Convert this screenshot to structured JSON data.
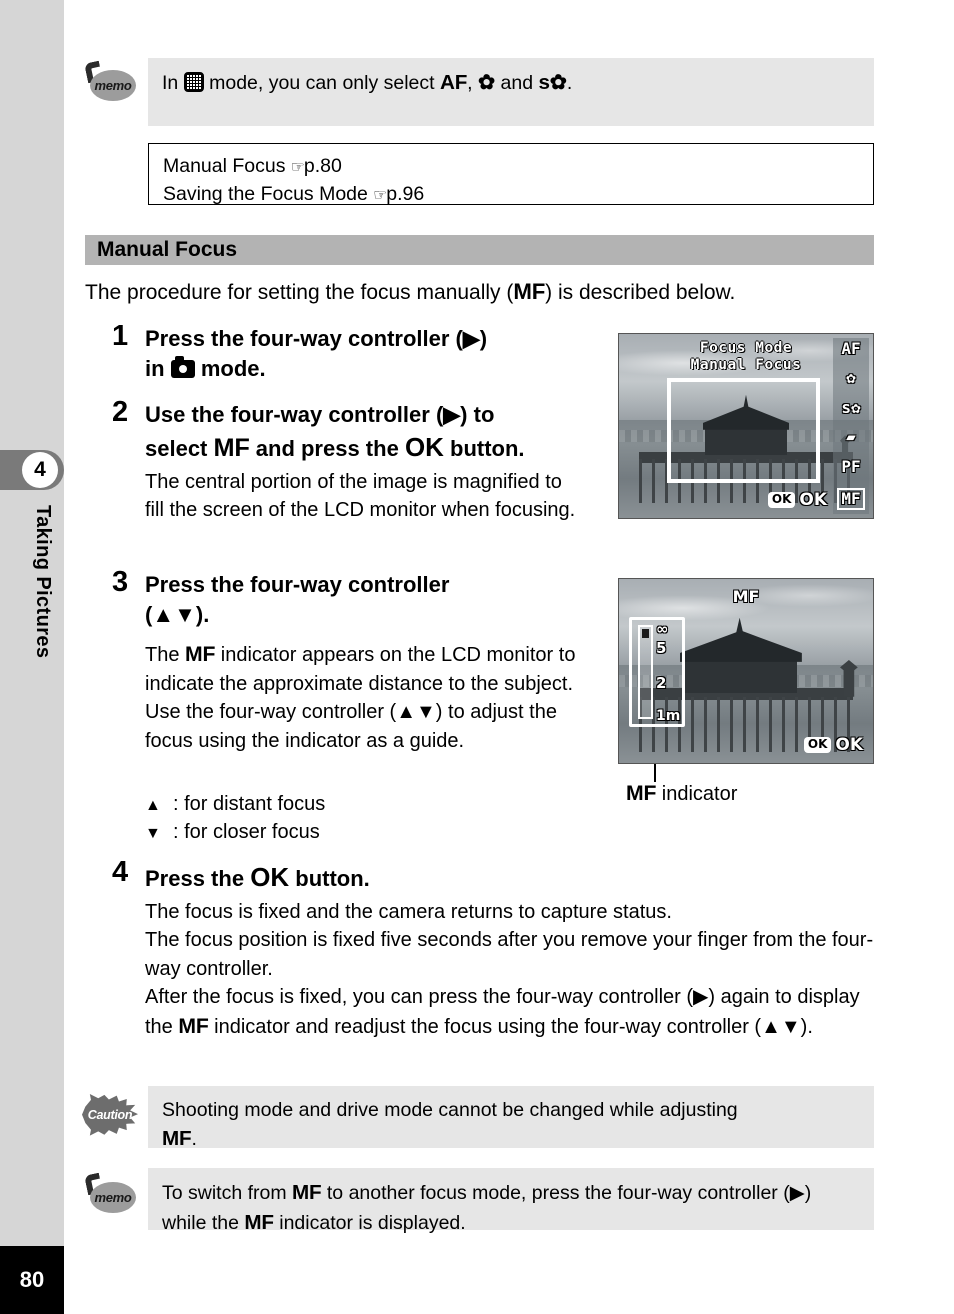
{
  "page": {
    "number": "80",
    "chapter_number": "4",
    "chapter_label": "Taking Pictures"
  },
  "memo_top": {
    "icon": "memo-icon",
    "icon_label": "memo",
    "text_before": "In",
    "mode_icon": "frame-composite-mode-icon",
    "text_after": "mode, you can only select",
    "option_af": "AF",
    "option_macro": "✿",
    "option_super_macro": "s✿",
    "text_end": "and"
  },
  "reference_box": {
    "items": [
      {
        "label": "Manual Focus",
        "pointer": "☞",
        "page": "p.80"
      },
      {
        "label": "Saving the Focus Mode",
        "pointer": "☞",
        "page": "p.96"
      }
    ]
  },
  "section": {
    "title": "Manual Focus",
    "intro_before": "The procedure for setting the focus manually (",
    "intro_mf": "MF",
    "intro_after": ") is described below."
  },
  "steps": [
    {
      "number": "1",
      "heading_line1": "Press the four-way controller (▶)",
      "heading_line2_before": "in",
      "heading_line2_icon": "capture-mode-camera-icon",
      "heading_line2_after": "mode.",
      "body": ""
    },
    {
      "number": "2",
      "heading_line1": "Use the four-way controller (▶) to",
      "heading_line2_a": "select",
      "heading_line2_mf": "MF",
      "heading_line2_b": "and press the",
      "heading_line2_ok": "OK",
      "heading_line2_c": "button.",
      "body": "The central portion of the image is magnified to fill the screen of the LCD monitor when focusing."
    },
    {
      "number": "3",
      "heading_line1": "Press the four-way controller",
      "heading_line2": "(▲▼).",
      "body_a": "The",
      "body_mf": "MF",
      "body_b": "indicator appears on the LCD monitor to indicate the approximate distance to the subject. Use the four-way controller (▲▼) to adjust the focus using the indicator as a guide.",
      "bullets": [
        {
          "glyph": "▲",
          "text": ": for distant focus"
        },
        {
          "glyph": "▼",
          "text": ": for closer focus"
        }
      ]
    },
    {
      "number": "4",
      "heading_a": "Press the",
      "heading_ok": "OK",
      "heading_b": "button.",
      "body_line1": "The focus is fixed and the camera returns to capture status.",
      "body_line2": "The focus position is fixed five seconds after you remove your finger from the four-way controller.",
      "body_line3_a": "After the focus is fixed, you can press the four-way controller (▶) again to display the",
      "body_line3_mf": "MF",
      "body_line3_b": "indicator and readjust the focus using the four-way controller (▲▼)."
    }
  ],
  "lcd_screen_1": {
    "title_line1": "Focus Mode",
    "title_line2": "Manual Focus",
    "mode_options": [
      "AF",
      "✿",
      "s✿",
      "▰",
      "PF",
      "MF"
    ],
    "selected_mode": "MF",
    "ok_chip": "OK",
    "ok_label": "OK"
  },
  "lcd_screen_2": {
    "mf_label": "MF",
    "scale_infinity": "∞",
    "scale_5": "5",
    "scale_2": "2",
    "scale_1m": "1m",
    "ok_chip": "OK",
    "ok_label": "OK",
    "caption_mf": "MF",
    "caption_text": "indicator"
  },
  "caution_box": {
    "icon": "caution-icon",
    "icon_label": "Caution",
    "text_a": "Shooting mode and drive mode cannot be changed while adjusting",
    "text_mf": "MF",
    "text_b": "."
  },
  "memo_bottom": {
    "icon": "memo-icon",
    "icon_label": "memo",
    "text_a": "To switch from",
    "text_mf1": "MF",
    "text_b": "to another focus mode, press the four-way controller (▶) while the",
    "text_mf2": "MF",
    "text_c": "indicator is displayed."
  },
  "colors": {
    "margin_band": "#d6d6d6",
    "chapter_tab": "#7a7a7a",
    "section_bar": "#b3b3b3",
    "note_bg": "#e6e6e6",
    "page_number_bg": "#000000"
  }
}
